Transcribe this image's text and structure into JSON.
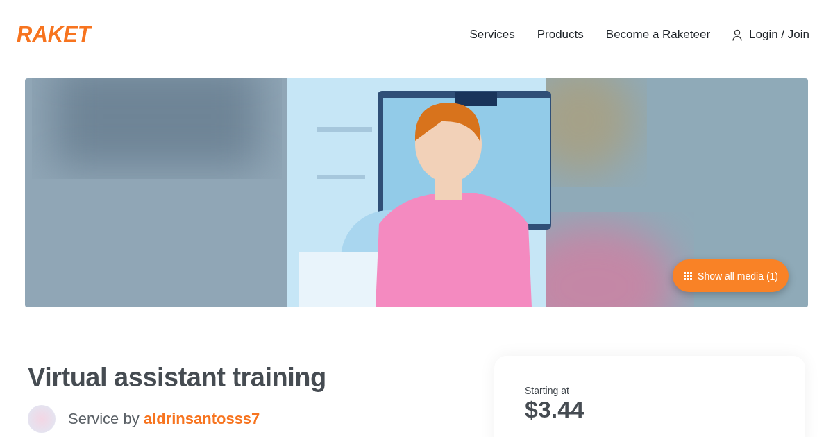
{
  "logo": "RAKET",
  "nav": [
    {
      "label": "Services"
    },
    {
      "label": "Products"
    },
    {
      "label": "Become a Raketeer"
    }
  ],
  "login": "Login / Join",
  "hero": {
    "kind": "picture",
    "button": "Show all media (1)"
  },
  "title": "Virtual assistant training",
  "service_by": "Service by",
  "author": "aldrinsantosss7",
  "price_card": {
    "label": "Starting at",
    "price": "$3.44"
  }
}
